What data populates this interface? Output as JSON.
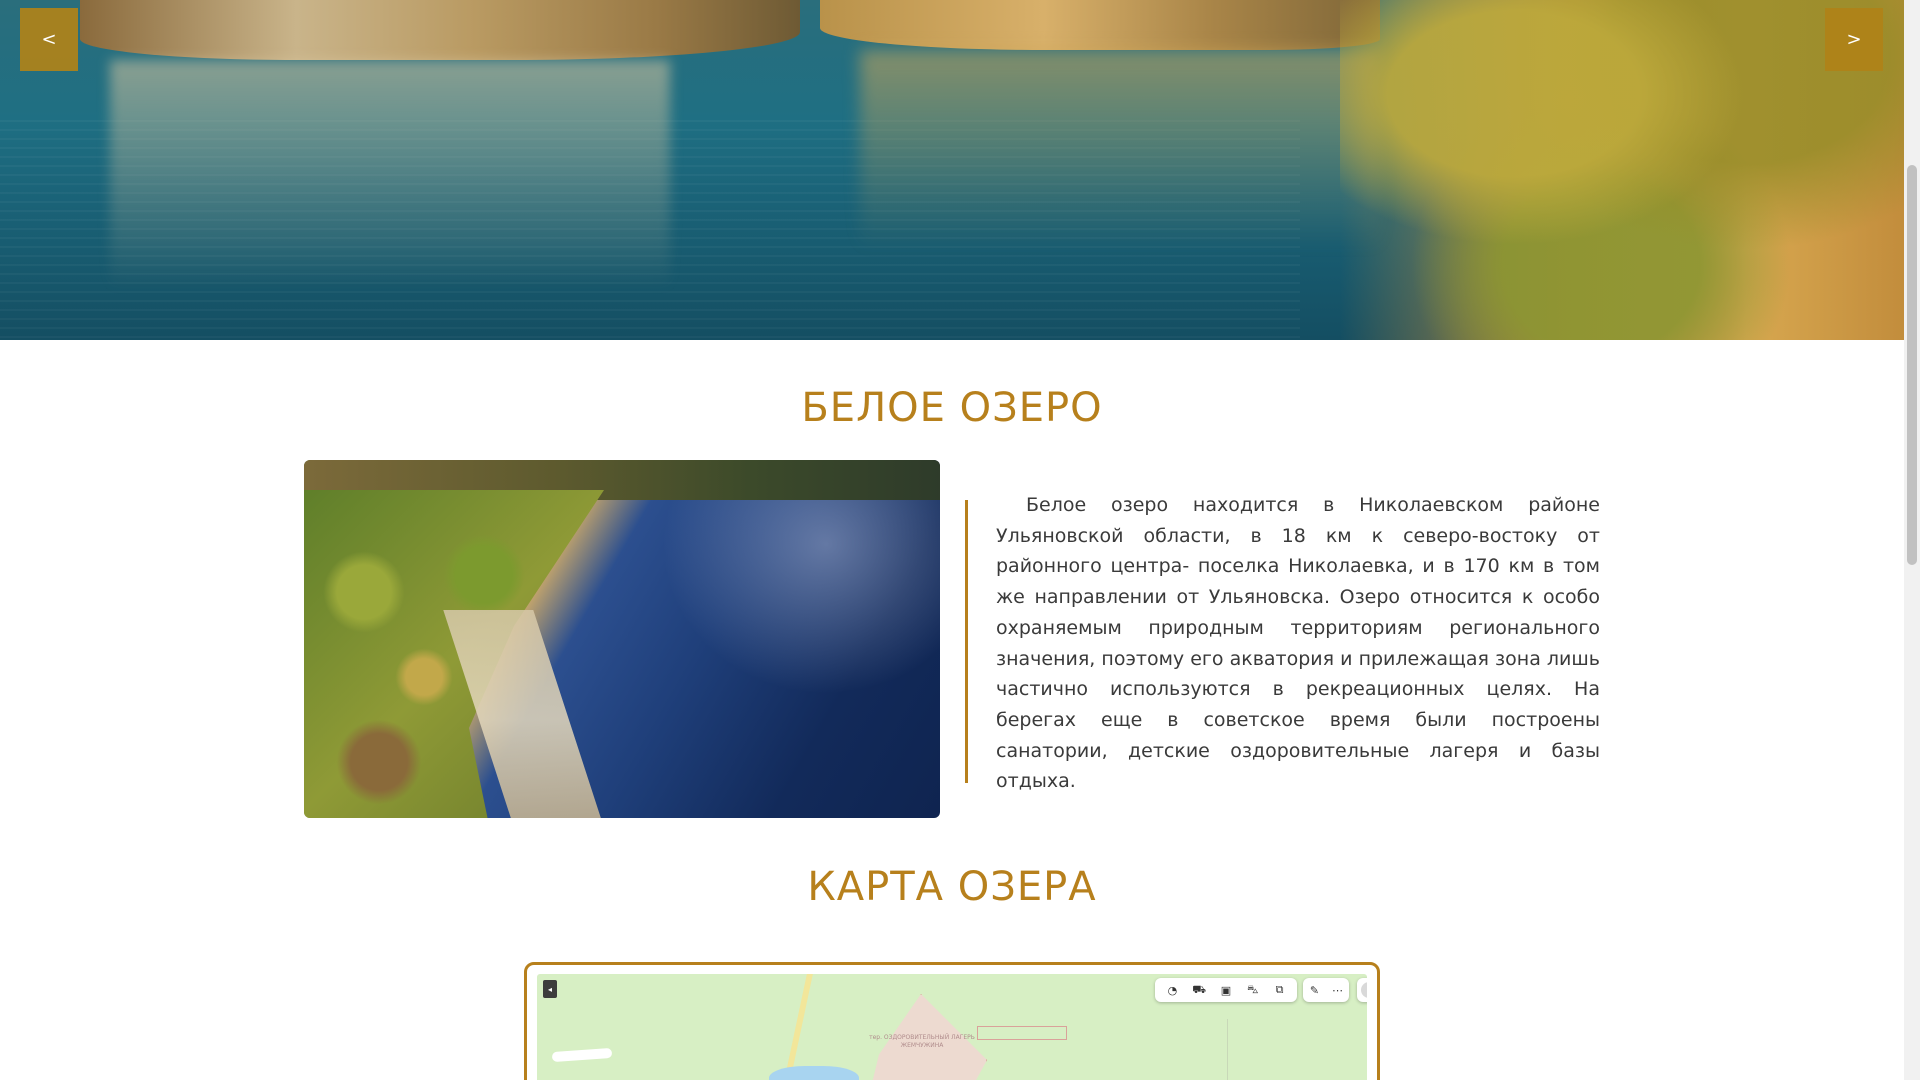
{
  "slider": {
    "prev_label": "<",
    "next_label": ">"
  },
  "lake_section": {
    "title": "БЕЛОЕ ОЗЕРО",
    "description": "Белое озеро находится в Николаевском районе Ульяновской области, в 18 км к северо-востоку от районного центра- поселка Николаевка, и в 170 км в том же направлении от Ульяновска. Озеро относится к особо охраняемым природным территориям регионального значения, поэтому его акватория и прилежащая зона лишь частично используются в рекреационных целях. На берегах еще в советское время были построены санатории, детские оздоровительные лагеря и базы отдыха."
  },
  "map_section": {
    "title": "КАРТА ОЗЕРА",
    "collapse_label": "◂",
    "camp_label": "тер. ОЗДОРОВИТЕЛЬНЫЙ ЛАГЕРЬ ЖЕМЧУЖИНА",
    "toolbar": [
      "◔",
      "⛟",
      "▣",
      "⛍",
      "⧉"
    ],
    "toolbar2": [
      "✎",
      "⋯"
    ]
  },
  "colors": {
    "accent": "#b7801c",
    "nav_button": "#b08218",
    "text": "#3a3a3a"
  }
}
